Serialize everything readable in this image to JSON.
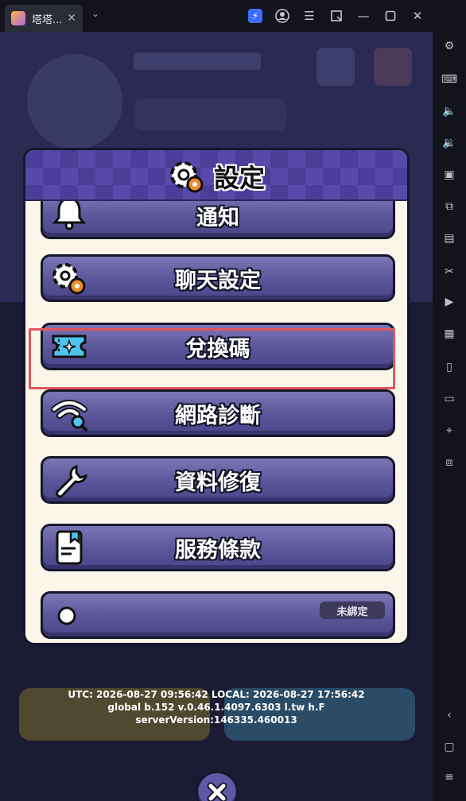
{
  "window": {
    "tab_title": "塔塔...",
    "tab_close": "✕",
    "dropdown": "⌄"
  },
  "settings": {
    "title": "設定",
    "items": [
      {
        "label": "通知",
        "icon": "bell-icon"
      },
      {
        "label": "聊天設定",
        "icon": "chat-settings-gear-icon"
      },
      {
        "label": "兌換碼",
        "icon": "ticket-icon"
      },
      {
        "label": "網路診斷",
        "icon": "wifi-search-icon"
      },
      {
        "label": "資料修復",
        "icon": "wrench-icon"
      },
      {
        "label": "服務條款",
        "icon": "document-icon"
      },
      {
        "label": "",
        "icon": "partially-visible-icon"
      }
    ],
    "badge": "未綁定"
  },
  "version_info": {
    "line1": "UTC: 2026-08-27 09:56:42 LOCAL: 2026-08-27 17:56:42",
    "line2": "global b.152 v.0.46.1.4097.6303 l.tw h.F",
    "line3": "serverVersion:146335.460013"
  },
  "colors": {
    "button_purple": "#5b559a",
    "highlight_red": "#e0565e",
    "dialog_bg": "#fbf6ea"
  }
}
